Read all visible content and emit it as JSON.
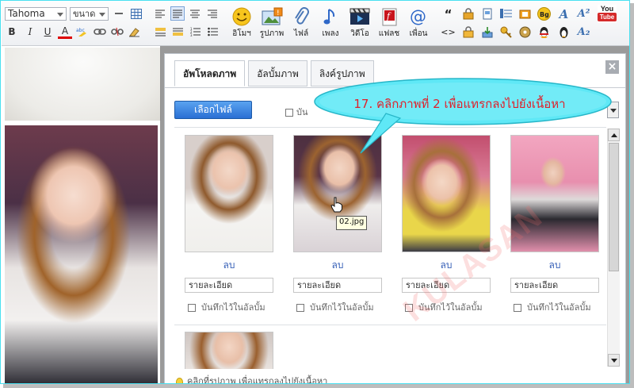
{
  "toolbar": {
    "font_name": "Tahoma",
    "font_size": "ขนาด",
    "format_buttons": [
      "B",
      "I",
      "U",
      "A"
    ],
    "big_buttons": [
      "อิโมฯ",
      "รูปภาพ",
      "ไฟล์",
      "เพลง",
      "วิดีโอ",
      "แฟลช",
      "เพื่อน"
    ],
    "small_labels": {
      "quote": "“",
      "code": "<>",
      "bg": "Bg",
      "font_a": "A",
      "sup": "A²",
      "sub": "A₂",
      "youtube_top": "You",
      "youtube_bottom": "Tube"
    }
  },
  "dialog": {
    "tabs": [
      "อัพโหลดภาพ",
      "อัลบั้มภาพ",
      "ลิงค์รูปภาพ"
    ],
    "close_label": "×",
    "choose_file_label": "เลือกไฟล์",
    "top_checkbox_label": "บัน",
    "images": [
      {
        "delete_label": "ลบ",
        "desc_value": "รายละเอียด",
        "save_label": "บันทึกไว้ในอัลบั้ม"
      },
      {
        "delete_label": "ลบ",
        "desc_value": "รายละเอียด",
        "save_label": "บันทึกไว้ในอัลบั้ม"
      },
      {
        "delete_label": "ลบ",
        "desc_value": "รายละเอียด",
        "save_label": "บันทึกไว้ในอัลบั้ม"
      },
      {
        "delete_label": "ลบ",
        "desc_value": "รายละเอียด",
        "save_label": "บันทึกไว้ในอัลบั้ม"
      }
    ],
    "tooltip": "02.jpg",
    "hint": "คลิกที่รูปภาพ เพื่อแทรกลงไปยังเนื้อหา"
  },
  "callout": {
    "text": "17. คลิกภาพที่ 2 เพื่อแทรกลงไปยังเนื้อหา"
  },
  "watermark": "KULASAN",
  "colors": {
    "accent_blue": "#2a6fd4",
    "callout_fill": "#5fe8f6",
    "callout_text": "#e0202a",
    "frame_border": "#49e0f0"
  }
}
